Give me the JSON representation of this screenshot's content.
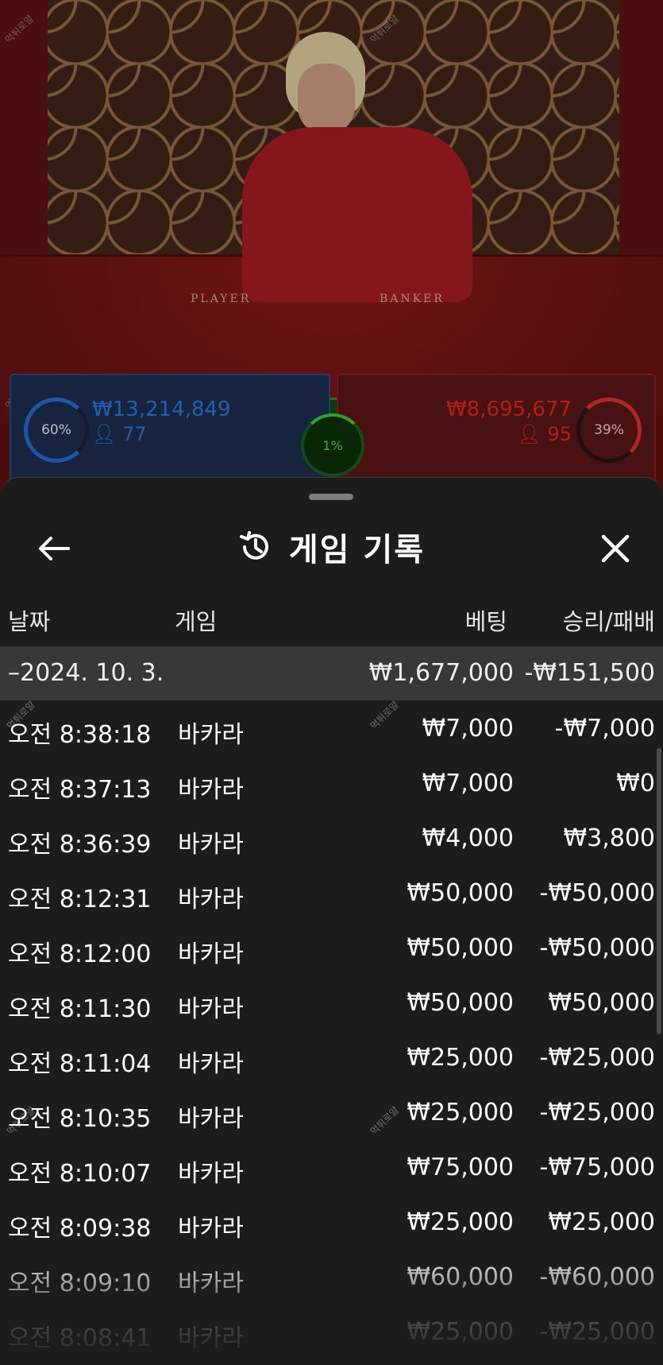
{
  "video": {
    "table_labels": {
      "player": "PLAYER",
      "banker": "BANKER"
    },
    "watermark_text": "먹튀로얄",
    "player": {
      "percent": "60%",
      "amount": "₩13,214,849",
      "count": "77"
    },
    "tie": {
      "percent": "1%"
    },
    "banker": {
      "percent": "39%",
      "amount": "₩8,695,677",
      "count": "95"
    },
    "colors": {
      "player": "#2f73d6",
      "banker": "#d92424",
      "tie": "#50d050"
    }
  },
  "sheet": {
    "title": "게임 기록",
    "icons": {
      "back": "back-arrow-icon",
      "history": "history-icon",
      "close": "close-icon"
    },
    "columns": {
      "date": "날짜",
      "game": "게임",
      "bet": "베팅",
      "result": "승리/패배"
    },
    "summary": {
      "date": "–2024. 10. 3.",
      "bet": "₩1,677,000",
      "result": "-₩151,500"
    },
    "rows": [
      {
        "time": "오전 8:38:18",
        "game": "바카라",
        "bet": "₩7,000",
        "result": "-₩7,000"
      },
      {
        "time": "오전 8:37:13",
        "game": "바카라",
        "bet": "₩7,000",
        "result": "₩0"
      },
      {
        "time": "오전 8:36:39",
        "game": "바카라",
        "bet": "₩4,000",
        "result": "₩3,800"
      },
      {
        "time": "오전 8:12:31",
        "game": "바카라",
        "bet": "₩50,000",
        "result": "-₩50,000"
      },
      {
        "time": "오전 8:12:00",
        "game": "바카라",
        "bet": "₩50,000",
        "result": "-₩50,000"
      },
      {
        "time": "오전 8:11:30",
        "game": "바카라",
        "bet": "₩50,000",
        "result": "₩50,000"
      },
      {
        "time": "오전 8:11:04",
        "game": "바카라",
        "bet": "₩25,000",
        "result": "-₩25,000"
      },
      {
        "time": "오전 8:10:35",
        "game": "바카라",
        "bet": "₩25,000",
        "result": "-₩25,000"
      },
      {
        "time": "오전 8:10:07",
        "game": "바카라",
        "bet": "₩75,000",
        "result": "-₩75,000"
      },
      {
        "time": "오전 8:09:38",
        "game": "바카라",
        "bet": "₩25,000",
        "result": "₩25,000"
      },
      {
        "time": "오전 8:09:10",
        "game": "바카라",
        "bet": "₩60,000",
        "result": "-₩60,000"
      },
      {
        "time": "오전 8:08:41",
        "game": "바카라",
        "bet": "₩25,000",
        "result": "-₩25,000"
      }
    ]
  }
}
